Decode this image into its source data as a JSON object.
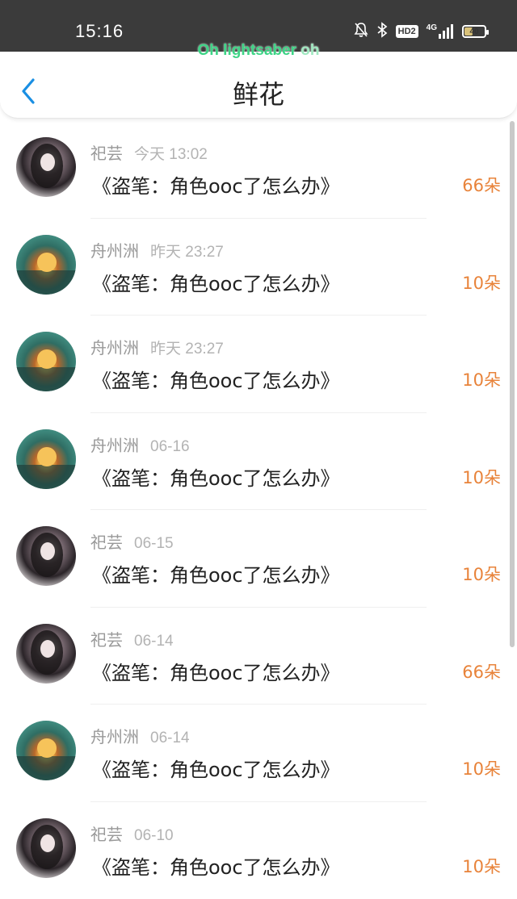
{
  "status_bar": {
    "time": "15:16",
    "icons": [
      "mute-bell-icon",
      "bluetooth-icon",
      "hd-voice-icon",
      "signal-4g-icon",
      "battery-icon"
    ],
    "hd_label": "HD2",
    "network_label": "4G",
    "battery_level": "40"
  },
  "lyric": {
    "bright": "Oh lightsaber ",
    "dim": "oh"
  },
  "header": {
    "title": "鲜花",
    "back_icon": "chevron-left-icon",
    "accent": "#1a8fe3"
  },
  "list": [
    {
      "name": "祀芸",
      "time": "今天 13:02",
      "title": "《盗笔：角色ooc了怎么办》",
      "flowers": "66朵",
      "avatar": "dark"
    },
    {
      "name": "舟州洲",
      "time": "昨天 23:27",
      "title": "《盗笔：角色ooc了怎么办》",
      "flowers": "10朵",
      "avatar": "teal"
    },
    {
      "name": "舟州洲",
      "time": "昨天 23:27",
      "title": "《盗笔：角色ooc了怎么办》",
      "flowers": "10朵",
      "avatar": "teal"
    },
    {
      "name": "舟州洲",
      "time": "06-16",
      "title": "《盗笔：角色ooc了怎么办》",
      "flowers": "10朵",
      "avatar": "teal"
    },
    {
      "name": "祀芸",
      "time": "06-15",
      "title": "《盗笔：角色ooc了怎么办》",
      "flowers": "10朵",
      "avatar": "dark"
    },
    {
      "name": "祀芸",
      "time": "06-14",
      "title": "《盗笔：角色ooc了怎么办》",
      "flowers": "66朵",
      "avatar": "dark"
    },
    {
      "name": "舟州洲",
      "time": "06-14",
      "title": "《盗笔：角色ooc了怎么办》",
      "flowers": "10朵",
      "avatar": "teal"
    },
    {
      "name": "祀芸",
      "time": "06-10",
      "title": "《盗笔：角色ooc了怎么办》",
      "flowers": "10朵",
      "avatar": "dark"
    }
  ],
  "colors": {
    "flowers": "#e8833a",
    "status_bar_bg": "#3b3b3b",
    "lyric": "#3ed486"
  }
}
